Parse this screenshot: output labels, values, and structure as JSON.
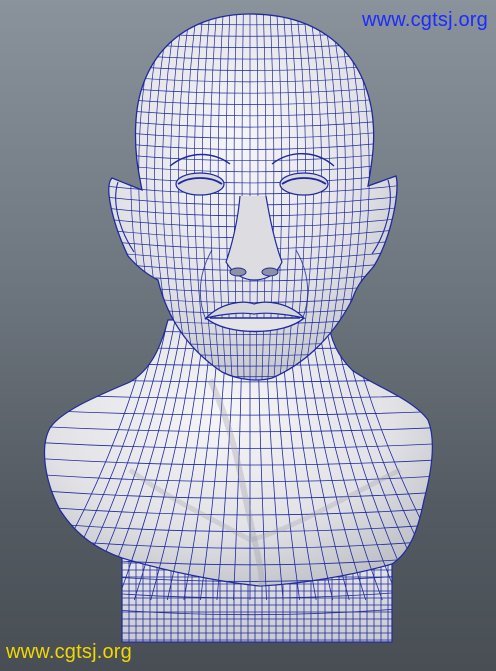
{
  "viewport": {
    "background_top": "#8a929b",
    "background_bottom": "#484e54"
  },
  "model": {
    "icon": "wireframe-head-bust-icon",
    "surface_color": "#e8e8ec",
    "wire_color": "#1f2a9e"
  },
  "watermarks": {
    "top_text": "www.cgtsj.org",
    "top_color": "#1a2cff",
    "bottom_text": "www.cgtsj.org",
    "bottom_color": "#f0d800"
  }
}
